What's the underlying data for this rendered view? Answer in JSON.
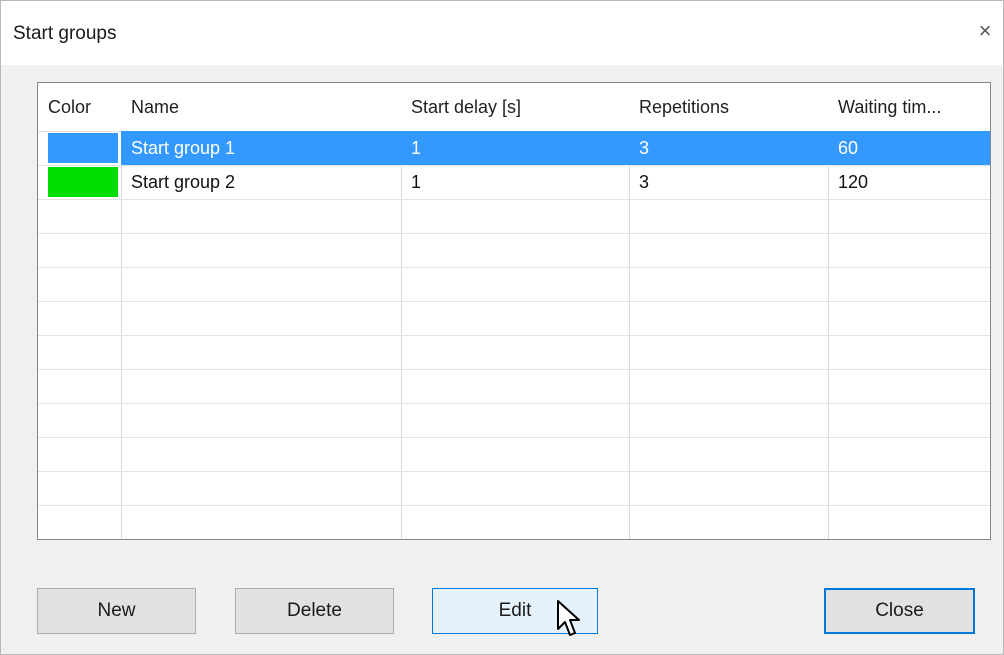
{
  "window": {
    "title": "Start groups",
    "close_glyph": "×"
  },
  "table": {
    "columns": [
      "Color",
      "Name",
      "Start delay [s]",
      "Repetitions",
      "Waiting tim..."
    ],
    "rows": [
      {
        "color": "#3399ff",
        "name": "Start group 1",
        "start_delay": "1",
        "repetitions": "3",
        "waiting_time": "60",
        "selected": true
      },
      {
        "color": "#00dd00",
        "name": "Start group 2",
        "start_delay": "1",
        "repetitions": "3",
        "waiting_time": "120",
        "selected": false
      }
    ]
  },
  "buttons": {
    "new": "New",
    "delete": "Delete",
    "edit": "Edit",
    "close": "Close"
  },
  "colors": {
    "selection": "#3399ff",
    "accent": "#0078d7"
  },
  "cursor": "arrow-pointer-icon"
}
